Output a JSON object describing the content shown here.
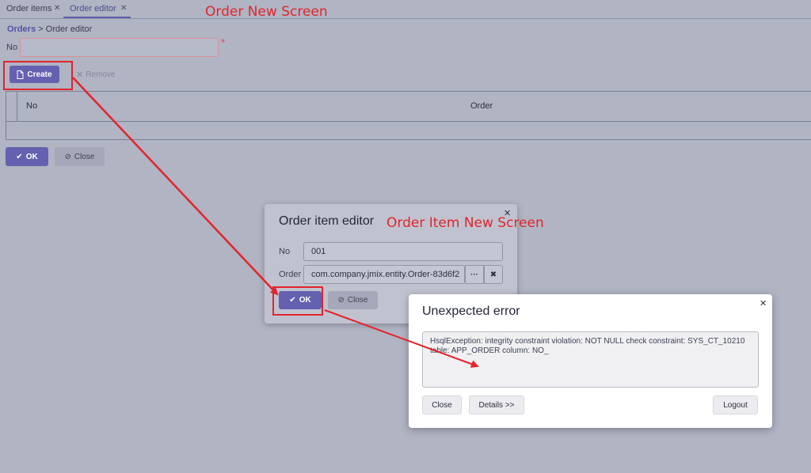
{
  "tabs": [
    {
      "label": "Order items",
      "active": false
    },
    {
      "label": "Order editor",
      "active": true
    }
  ],
  "annotations": {
    "order_screen": "Order New Screen",
    "order_item_screen": "Order Item New Screen"
  },
  "breadcrumb": {
    "parent": "Orders",
    "separator": ">",
    "current": "Order editor"
  },
  "order_form": {
    "no_label": "No",
    "no_value": "",
    "required_mark": "*",
    "create_label": "Create",
    "remove_label": "Remove",
    "table": {
      "columns": [
        "No",
        "Order"
      ],
      "rows": []
    },
    "ok_label": "OK",
    "close_label": "Close"
  },
  "order_item_dialog": {
    "title": "Order item editor",
    "no_label": "No",
    "no_value": "001",
    "order_label": "Order",
    "order_value": "com.company.jmix.entity.Order-83d6f2",
    "pick_label": "···",
    "clear_label": "✖",
    "ok_label": "OK",
    "close_label": "Close"
  },
  "error_dialog": {
    "title": "Unexpected error",
    "message": "HsqlException: integrity constraint violation: NOT NULL check constraint: SYS_CT_10210 table: APP_ORDER column: NO_",
    "close_label": "Close",
    "details_label": "Details >>",
    "logout_label": "Logout"
  },
  "colors": {
    "primary": "#6660b0",
    "annotation": "#e3242b",
    "required": "#e04357",
    "overlay_bg": "#b0b4c3"
  }
}
